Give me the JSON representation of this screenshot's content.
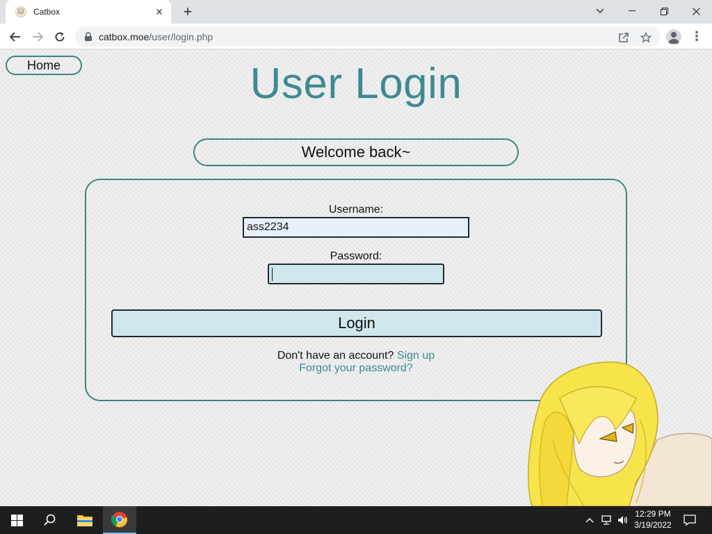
{
  "browser": {
    "tab_title": "Catbox",
    "url_host": "catbox.moe",
    "url_path": "/user/login.php"
  },
  "page": {
    "home_label": "Home",
    "title": "User Login",
    "welcome": "Welcome back~",
    "username_label": "Username:",
    "username_value": "ass2234",
    "password_label": "Password:",
    "password_value": "",
    "login_label": "Login",
    "no_account_text": "Don't have an account?",
    "signup_link": "Sign up",
    "forgot_link": "Forgot your password?"
  },
  "taskbar": {
    "time": "12:29 PM",
    "date": "3/19/2022"
  },
  "colors": {
    "accent": "#3f8a92",
    "border": "#3f8383",
    "input_bg": "#e8f0fe",
    "button_bg": "#cfe6ea"
  }
}
